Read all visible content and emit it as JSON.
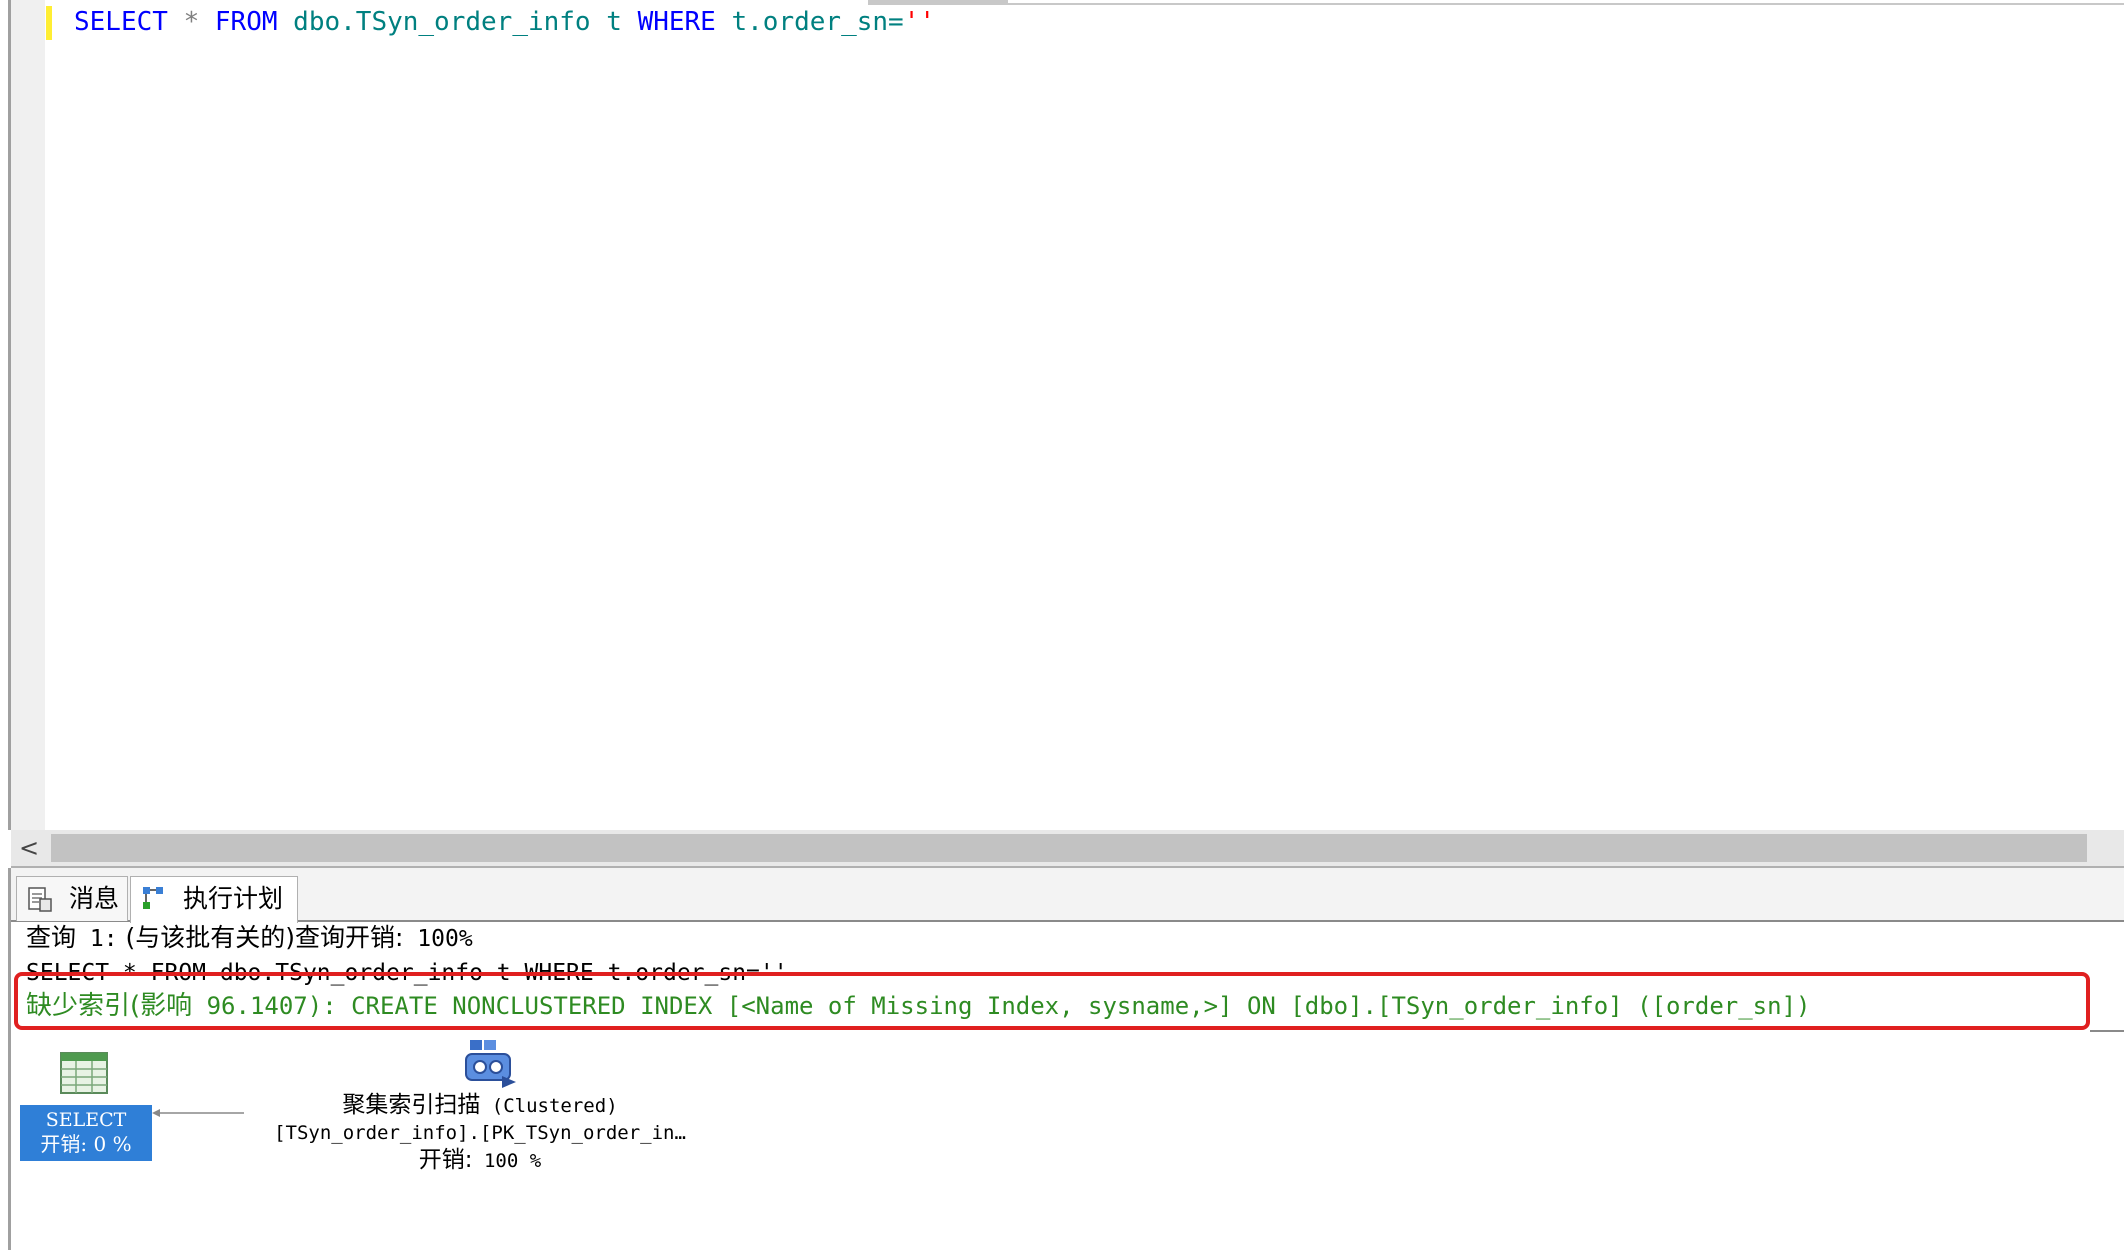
{
  "editor": {
    "code": {
      "kw_select": "SELECT",
      "star": "*",
      "kw_from": "FROM",
      "table": "dbo.TSyn_order_info",
      "alias": "t",
      "kw_where": "WHERE",
      "column": "t.order_sn=",
      "literal": "''"
    }
  },
  "scrollbar": {
    "left_arrow": "<"
  },
  "tabs": [
    {
      "label": "消息",
      "icon": "message-icon"
    },
    {
      "label": "执行计划",
      "icon": "execution-plan-icon"
    }
  ],
  "plan": {
    "query_header_prefix": "查询",
    "query_header_num": " 1:",
    "query_header_zh": " (与该批有关的)查询开销:",
    "query_header_cost": " 100%",
    "sql_text": "SELECT * FROM dbo.TSyn_order_info t WHERE t.order_sn=''",
    "missing_index_zh": "缺少索引(影响",
    "missing_index_impact": " 96.1407): CREATE NONCLUSTERED INDEX [<Name of Missing Index, sysname,>] ON [dbo].[TSyn_order_info] ([order_sn])",
    "select_node": {
      "name": "SELECT",
      "cost_label": "开销: 0 %"
    },
    "scan_node": {
      "name_zh": "聚集索引扫描",
      "name_en": " (Clustered)",
      "object": "[TSyn_order_info].[PK_TSyn_order_in…",
      "cost_zh": "开销:",
      "cost_value": " 100 %"
    }
  },
  "colors": {
    "highlight": "#e02020",
    "select_node_bg": "#2f7fd7",
    "missing_index_text": "#2e8b22"
  }
}
